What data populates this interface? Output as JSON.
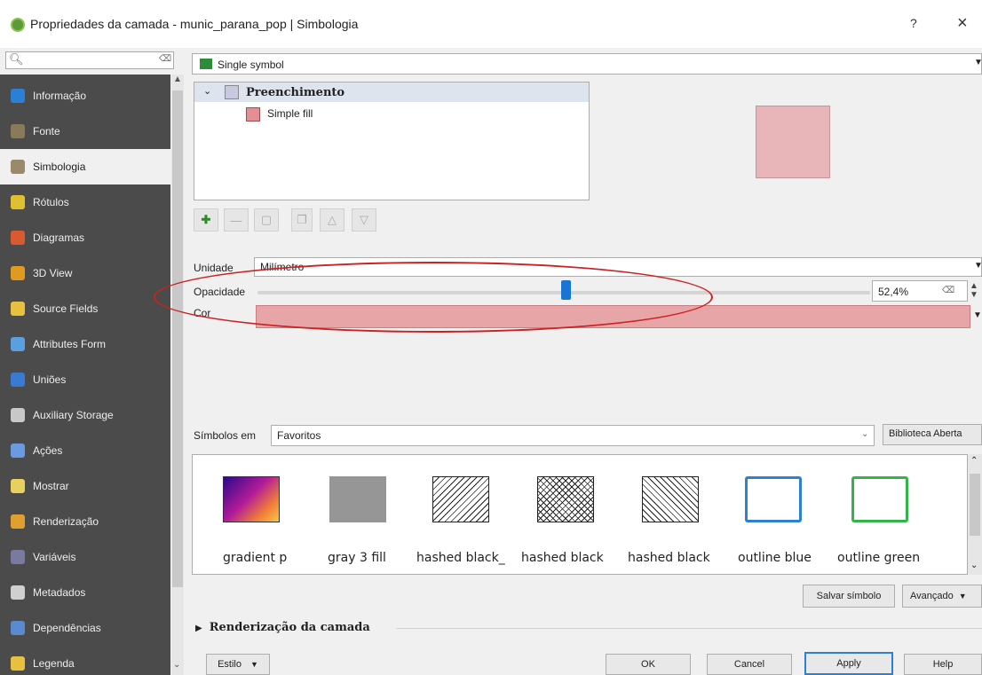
{
  "window": {
    "title": "Propriedades da camada - munic_parana_pop | Simbologia",
    "help_label": "?",
    "close_label": "×"
  },
  "search": {
    "icon": "search-icon",
    "placeholder": ""
  },
  "sidebar": {
    "items": [
      {
        "label": "Informação",
        "icon": "info-icon",
        "color": "#2b7fd4"
      },
      {
        "label": "Fonte",
        "icon": "source-icon",
        "color": "#8a7a5a"
      },
      {
        "label": "Simbologia",
        "icon": "brush-icon",
        "color": "#9a8a6a",
        "selected": true
      },
      {
        "label": "Rótulos",
        "icon": "labels-icon",
        "color": "#e0c030"
      },
      {
        "label": "Diagramas",
        "icon": "diagram-icon",
        "color": "#d85a30"
      },
      {
        "label": "3D View",
        "icon": "cube-icon",
        "color": "#e09a20"
      },
      {
        "label": "Source Fields",
        "icon": "fields-icon",
        "color": "#e8c040"
      },
      {
        "label": "Attributes Form",
        "icon": "form-icon",
        "color": "#5aa0e0"
      },
      {
        "label": "Uniões",
        "icon": "join-icon",
        "color": "#3a7ad0"
      },
      {
        "label": "Auxiliary Storage",
        "icon": "storage-icon",
        "color": "#c8c8c8"
      },
      {
        "label": "Ações",
        "icon": "actions-icon",
        "color": "#6a9ae0"
      },
      {
        "label": "Mostrar",
        "icon": "display-icon",
        "color": "#e8d060"
      },
      {
        "label": "Renderização",
        "icon": "render-icon",
        "color": "#e0a030"
      },
      {
        "label": "Variáveis",
        "icon": "variables-icon",
        "color": "#7a7aa0"
      },
      {
        "label": "Metadados",
        "icon": "metadata-icon",
        "color": "#d0d0d0"
      },
      {
        "label": "Dependências",
        "icon": "dependencies-icon",
        "color": "#5a8ad0"
      },
      {
        "label": "Legenda",
        "icon": "legend-icon",
        "color": "#e8c040"
      }
    ]
  },
  "renderer": {
    "type_label": "Single symbol"
  },
  "symbol_tree": {
    "root_label": "Preenchimento",
    "child_label": "Simple fill",
    "fill_color": "#e8b5b8"
  },
  "layer_tools": [
    "add-layer-icon",
    "remove-layer-icon",
    "lock-icon",
    "duplicate-icon",
    "move-up-icon",
    "move-down-icon"
  ],
  "properties": {
    "unit_label": "Unidade",
    "unit_value": "Milímetro",
    "opacity_label": "Opacidade",
    "opacity_value": "52,4%",
    "opacity_fraction": 0.524,
    "color_label": "Cor",
    "color_value": "#e8a5a8"
  },
  "symbols": {
    "label": "Símbolos em",
    "group": "Favoritos",
    "library_button": "Biblioteca Aberta",
    "items": [
      {
        "label": "gradient  p",
        "kind": "gradient"
      },
      {
        "label": "gray 3 fill",
        "kind": "gray"
      },
      {
        "label": "hashed black_",
        "kind": "hash-diag"
      },
      {
        "label": "hashed black",
        "kind": "hash-cross"
      },
      {
        "label": "hashed black",
        "kind": "hash-back"
      },
      {
        "label": "outline blue",
        "kind": "outline",
        "color": "#2f7fd6"
      },
      {
        "label": "outline green",
        "kind": "outline",
        "color": "#34b34a"
      }
    ],
    "save_button": "Salvar símbolo",
    "advanced_button": "Avançado"
  },
  "rendering_section": {
    "label": "Renderização da camada"
  },
  "footer": {
    "style_button": "Estilo",
    "ok": "OK",
    "cancel": "Cancel",
    "apply": "Apply",
    "help": "Help"
  }
}
